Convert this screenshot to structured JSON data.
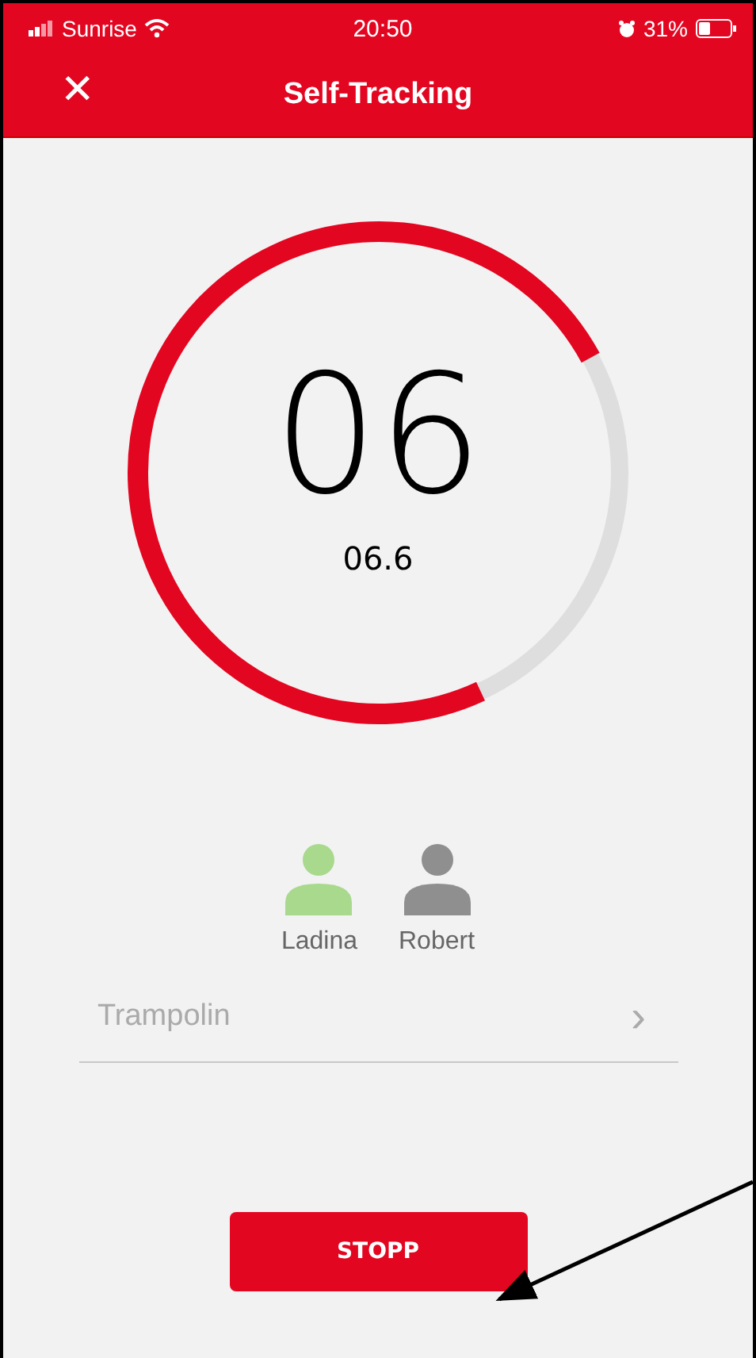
{
  "status_bar": {
    "carrier": "Sunrise",
    "time": "20:50",
    "battery_percent": "31%"
  },
  "header": {
    "close_glyph": "✕",
    "title": "Self-Tracking"
  },
  "timer": {
    "level": 0.74,
    "count": "06",
    "elapsed": "06.6"
  },
  "participants": [
    {
      "name": "Ladina",
      "selected": true
    },
    {
      "name": "Robert",
      "selected": false
    }
  ],
  "activity": {
    "value": "Trampolin",
    "chevron": "›"
  },
  "stop_button": {
    "label": "STOPP"
  }
}
